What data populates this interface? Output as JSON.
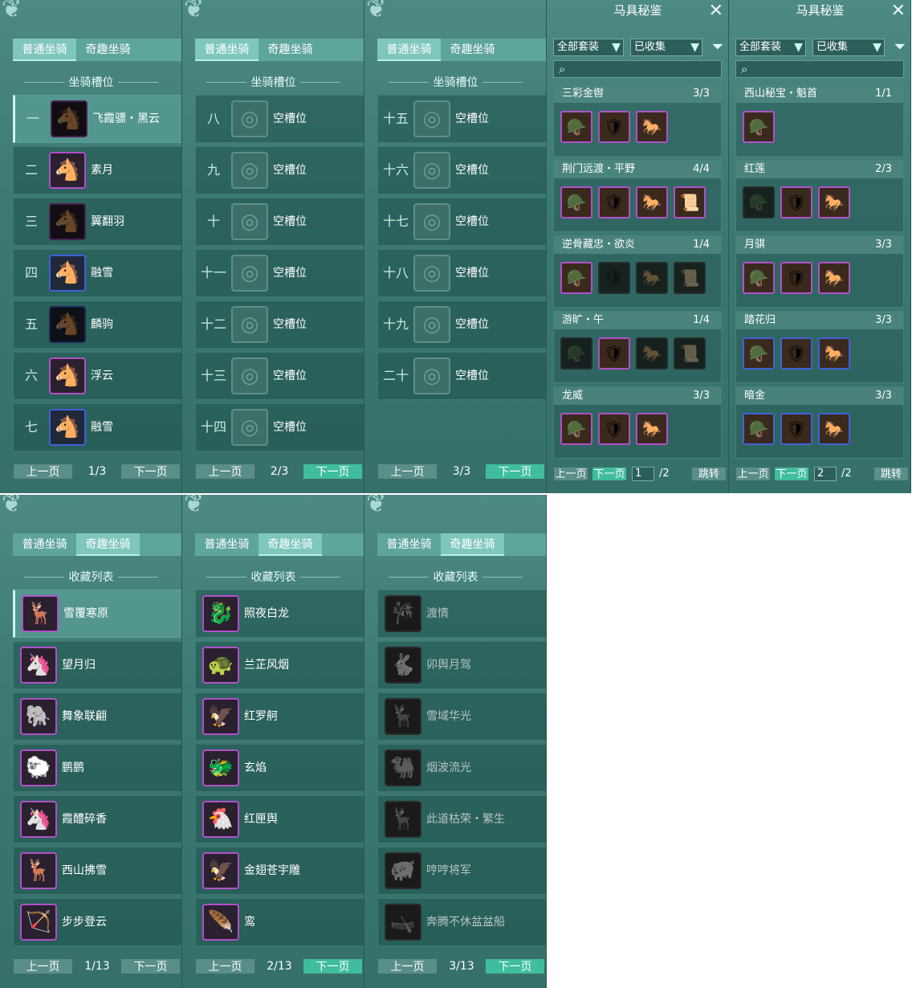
{
  "tabs": {
    "normal": "普通坐骑",
    "fun": "奇趣坐骑"
  },
  "section_slots": "坐骑槽位",
  "section_collection": "收藏列表",
  "pager": {
    "prev": "上一页",
    "next": "下一页",
    "jump": "跳转"
  },
  "slot_pages": [
    {
      "page": "1/3",
      "slots": [
        {
          "num": "一",
          "name": "飞霞骠・黑云",
          "type": "black",
          "border": "purple"
        },
        {
          "num": "二",
          "name": "素月",
          "type": "white",
          "border": "purple"
        },
        {
          "num": "三",
          "name": "翼翻羽",
          "type": "black",
          "border": "purple"
        },
        {
          "num": "四",
          "name": "融雪",
          "type": "white",
          "border": "blue"
        },
        {
          "num": "五",
          "name": "麟驹",
          "type": "black",
          "border": "blue"
        },
        {
          "num": "六",
          "name": "浮云",
          "type": "white",
          "border": "purple"
        },
        {
          "num": "七",
          "name": "融雪",
          "type": "white",
          "border": "blue"
        }
      ]
    },
    {
      "page": "2/3",
      "slots": [
        {
          "num": "八",
          "name": "空槽位"
        },
        {
          "num": "九",
          "name": "空槽位"
        },
        {
          "num": "十",
          "name": "空槽位"
        },
        {
          "num": "十一",
          "name": "空槽位"
        },
        {
          "num": "十二",
          "name": "空槽位"
        },
        {
          "num": "十三",
          "name": "空槽位"
        },
        {
          "num": "十四",
          "name": "空槽位"
        }
      ]
    },
    {
      "page": "3/3",
      "slots": [
        {
          "num": "十五",
          "name": "空槽位"
        },
        {
          "num": "十六",
          "name": "空槽位"
        },
        {
          "num": "十七",
          "name": "空槽位"
        },
        {
          "num": "十八",
          "name": "空槽位"
        },
        {
          "num": "十九",
          "name": "空槽位"
        },
        {
          "num": "二十",
          "name": "空槽位"
        }
      ]
    }
  ],
  "collection_pages": [
    {
      "page": "1/13",
      "items": [
        "雪覆寒原",
        "望月归",
        "舞象联翩",
        "鹏鹏",
        "霞醴碎香",
        "西山拂雪",
        "步步登云"
      ]
    },
    {
      "page": "2/13",
      "items": [
        "照夜白龙",
        "兰芷风烟",
        "红罗舸",
        "玄焰",
        "红匣舆",
        "金翅苍宇雕",
        "鸾"
      ]
    },
    {
      "page": "3/13",
      "items": [
        "渡情",
        "卯舆月驾",
        "雪域华光",
        "烟波流光",
        "此道枯荣・繁生",
        "哼哼将军",
        "奔腾不休盆盆船"
      ],
      "dim": true
    }
  ],
  "harness": {
    "title": "马具秘鉴",
    "filter_set": "全部套装",
    "filter_collected": "已收集",
    "panels": [
      {
        "page_input": "1",
        "total": "/2",
        "sets": [
          {
            "name": "三彩金辔",
            "count": "3/3",
            "items": [
              "p",
              "p",
              "p"
            ]
          },
          {
            "name": "荆门远渡・平野",
            "count": "4/4",
            "items": [
              "p",
              "p",
              "p",
              "p"
            ]
          },
          {
            "name": "逆骨藏忠・欲炎",
            "count": "1/4",
            "items": [
              "p",
              "n",
              "n",
              "n"
            ]
          },
          {
            "name": "游旷・午",
            "count": "1/4",
            "items": [
              "n",
              "p",
              "n",
              "n"
            ]
          },
          {
            "name": "龙威",
            "count": "3/3",
            "items": [
              "p",
              "p",
              "p"
            ]
          }
        ]
      },
      {
        "page_input": "2",
        "total": "/2",
        "sets": [
          {
            "name": "西山秘宝・魁首",
            "count": "1/1",
            "items": [
              "p"
            ]
          },
          {
            "name": "红莲",
            "count": "2/3",
            "items": [
              "n",
              "p",
              "p"
            ]
          },
          {
            "name": "月骐",
            "count": "3/3",
            "items": [
              "p",
              "p",
              "p"
            ]
          },
          {
            "name": "踏花归",
            "count": "3/3",
            "items": [
              "b",
              "b",
              "b"
            ]
          },
          {
            "name": "暗金",
            "count": "3/3",
            "items": [
              "b",
              "b",
              "b"
            ]
          }
        ]
      }
    ]
  },
  "colors": {
    "panel": "#3d7a74",
    "accent_green": "#3fbd9c",
    "purple_frame": "#b050c8",
    "blue_frame": "#4060d8"
  }
}
